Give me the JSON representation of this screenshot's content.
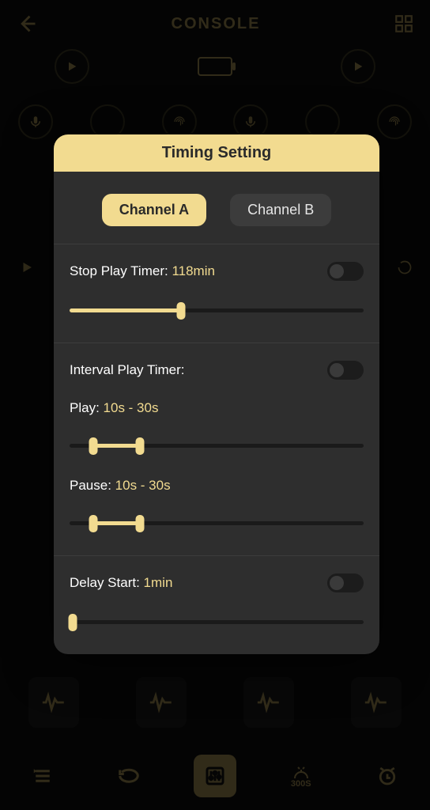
{
  "header": {
    "title": "CONSOLE"
  },
  "modal": {
    "title": "Timing Setting",
    "tabs": {
      "a": "Channel A",
      "b": "Channel B",
      "active": "a"
    },
    "stop_timer": {
      "label": "Stop Play Timer: ",
      "value": "118min",
      "percent": 38,
      "enabled": false
    },
    "interval": {
      "label": "Interval Play Timer:",
      "enabled": false,
      "play": {
        "label": "Play: ",
        "value": "10s - 30s",
        "low_pct": 8,
        "high_pct": 24
      },
      "pause": {
        "label": "Pause: ",
        "value": "10s - 30s",
        "low_pct": 8,
        "high_pct": 24
      }
    },
    "delay": {
      "label": "Delay Start: ",
      "value": "1min",
      "percent": 1,
      "enabled": false
    }
  },
  "nav": {
    "timer_label": "300S"
  }
}
